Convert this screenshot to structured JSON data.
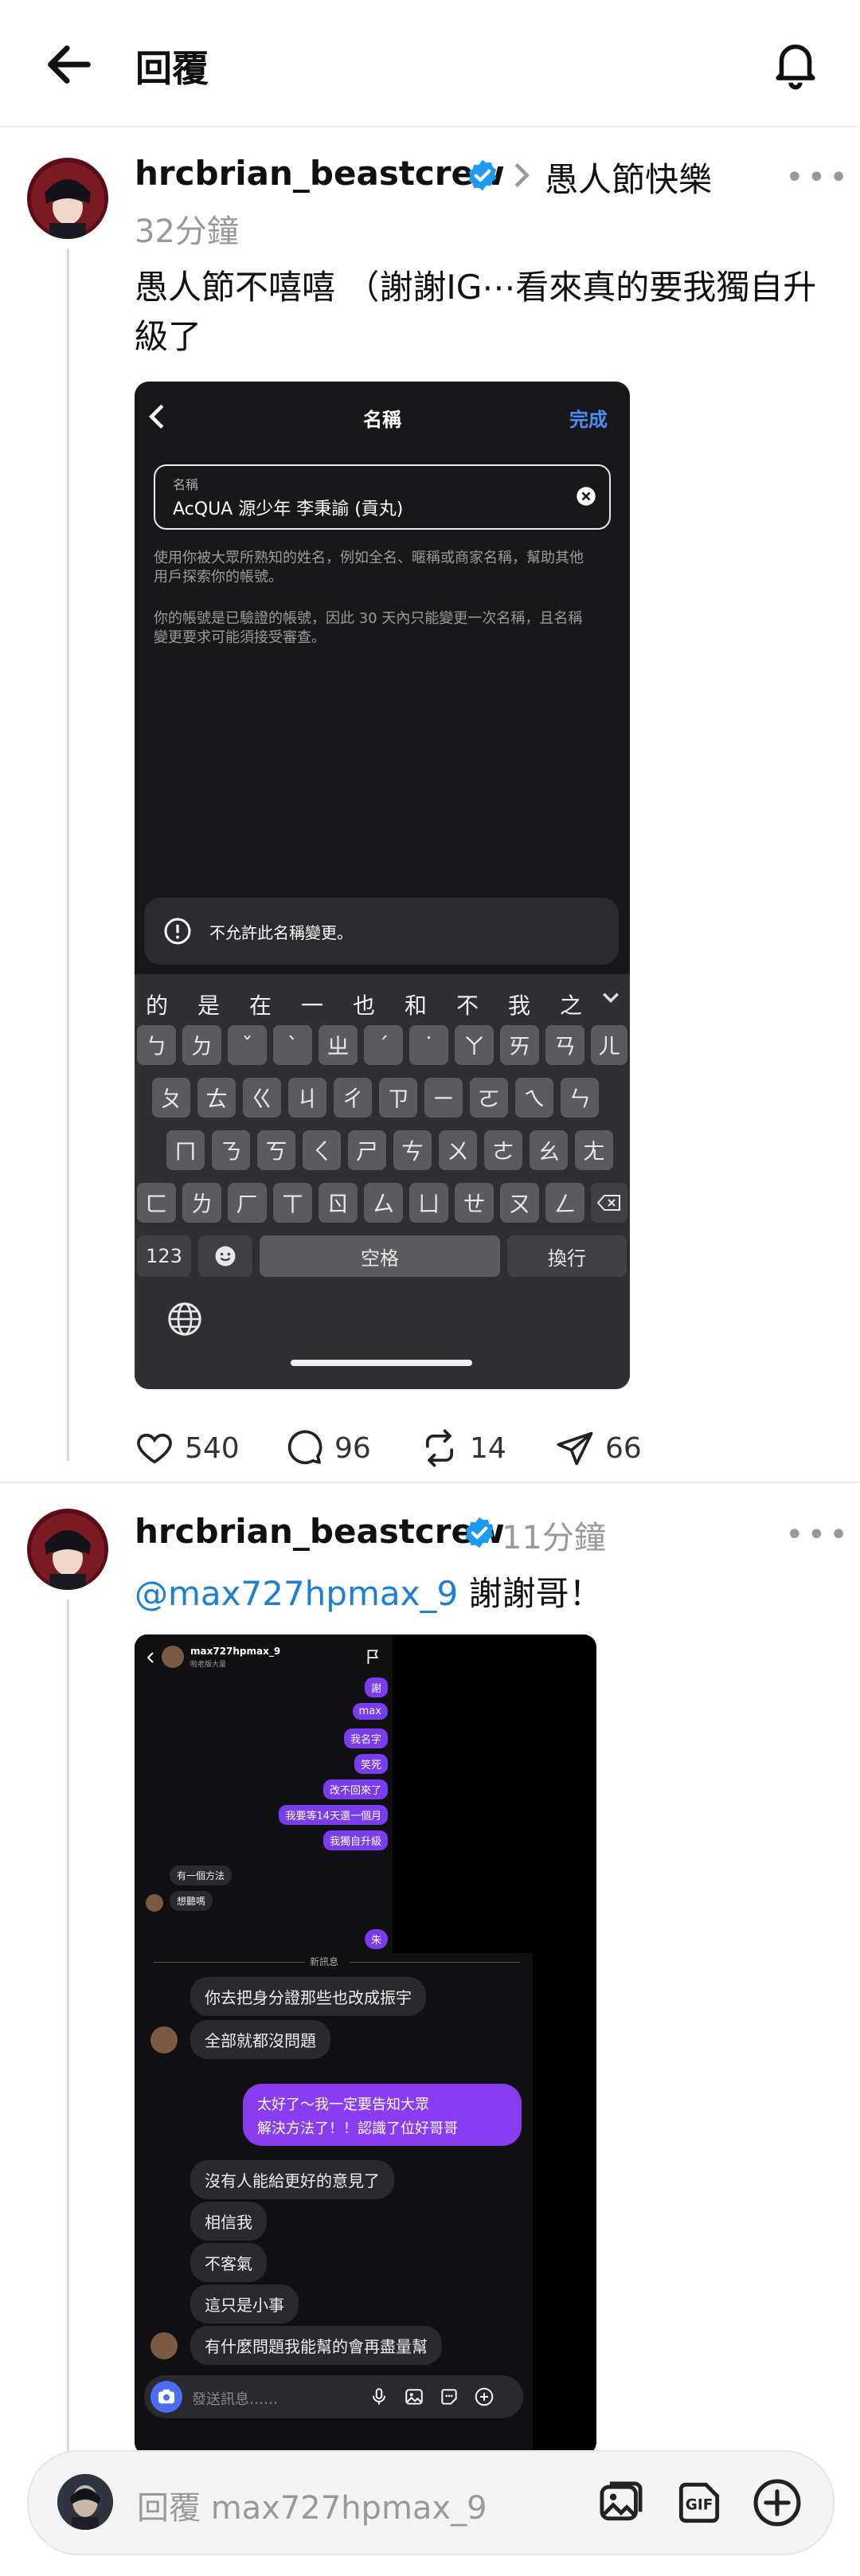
{
  "header": {
    "title": "回覆",
    "back_icon": "arrow-left-icon",
    "bell_icon": "bell-icon"
  },
  "post1": {
    "username": "hrcbrian_beastcrew",
    "context": "愚人節快樂",
    "time": "32分鐘",
    "text": "愚人節不嘻嘻 （謝謝IG⋯看來真的要我獨自升級了",
    "more": "•••",
    "likes": "540",
    "comments": "96",
    "reposts": "14",
    "shares": "66",
    "screenshot": {
      "nav_title": "名稱",
      "done": "完成",
      "field_label": "名稱",
      "field_value": "AcQUA 源少年 李秉諭 (貢丸)",
      "help1": "使用你被大眾所熟知的姓名，例如全名、暱稱或商家名稱，幫助其他用戶探索你的帳號。",
      "help2": "你的帳號是已驗證的帳號，因此 30 天內只能變更一次名稱，且名稱變更要求可能須接受審查。",
      "error": "不允許此名稱變更。",
      "suggestions": [
        "的",
        "是",
        "在",
        "一",
        "也",
        "和",
        "不",
        "我",
        "之"
      ],
      "row1": [
        "ㄅ",
        "ㄉ",
        "ˇ",
        "ˋ",
        "ㄓ",
        "ˊ",
        "˙",
        "ㄚ",
        "ㄞ",
        "ㄢ",
        "ㄦ"
      ],
      "row2": [
        "ㄆ",
        "ㄊ",
        "ㄍ",
        "ㄐ",
        "ㄔ",
        "ㄗ",
        "ㄧ",
        "ㄛ",
        "ㄟ",
        "ㄣ"
      ],
      "row3": [
        "ㄇ",
        "ㄋ",
        "ㄎ",
        "ㄑ",
        "ㄕ",
        "ㄘ",
        "ㄨ",
        "ㄜ",
        "ㄠ",
        "ㄤ"
      ],
      "row4": [
        "ㄈ",
        "ㄌ",
        "ㄏ",
        "ㄒ",
        "ㄖ",
        "ㄙ",
        "ㄩ",
        "ㄝ",
        "ㄡ",
        "ㄥ"
      ],
      "key_123": "123",
      "space": "空格",
      "return": "換行"
    }
  },
  "post2": {
    "username": "hrcbrian_beastcrew",
    "time": "11分鐘",
    "mention": "@max727hpmax_9",
    "text": " 謝謝哥！",
    "more": "•••",
    "screenshot": {
      "chat_user": "max727hpmax_9",
      "chat_sub": "啦老版大量",
      "purple_top": [
        "謝",
        "max",
        "我名字",
        "笑死",
        "改不回來了",
        "我要等14天還一個月",
        "我獨自升級"
      ],
      "gray_small": [
        "有一個方法",
        "想聽嗎"
      ],
      "purple_single": "朱",
      "divider": "新訊息",
      "gray_a": [
        "你去把身分證那些也改成振宇",
        "全部就都沒問題"
      ],
      "purple_reply_line1": "太好了～我一定要告知大眾",
      "purple_reply_line2": "解決方法了！！認識了位好哥哥",
      "gray_b": [
        "沒有人能給更好的意見了",
        "相信我",
        "不客氣",
        "這只是小事",
        "有什麼問題我能幫的會再盡量幫"
      ],
      "input_placeholder": "發送訊息……"
    }
  },
  "reply": {
    "placeholder": "回覆 max727hpmax_9"
  }
}
